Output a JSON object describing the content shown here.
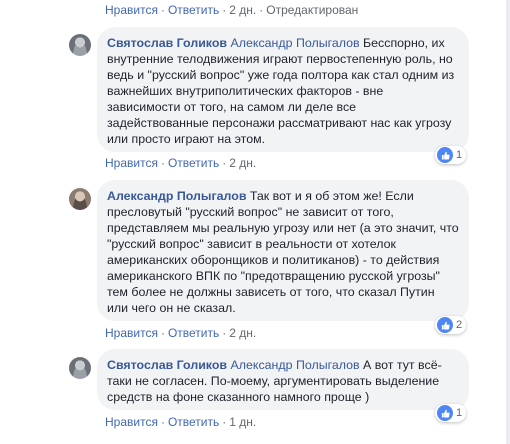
{
  "top_actions": {
    "like": "Нравится",
    "reply": "Ответить",
    "time": "2 дн.",
    "edited": "Отредактирован"
  },
  "comments": [
    {
      "author": "Святослав Голиков",
      "mention": "Александр Полыгалов",
      "text": " Бесспорно, их внутренние телодвижения играют первостепенную роль, но ведь и \"русский вопрос\" уже года полтора как стал одним из важнейших внутриполитических факторов - вне зависимости от того, на самом ли деле все задействованные персонажи рассматривают нас как угрозу или просто играют на этом.",
      "like": "Нравится",
      "reply": "Ответить",
      "time": "2 дн.",
      "reactions": "1"
    },
    {
      "author": "Александр Полыгалов",
      "mention": "",
      "text": " Так вот и я об этом же! Если пресловутый \"русский вопрос\" не зависит от того, представляем мы реальную угрозу или нет (а это значит, что \"русский вопрос\" зависит в реальности от хотелок американских оборонщиков и политиканов) - то действия американского ВПК по \"предотвращению русской угрозы\" тем более не должны зависеть от того, что сказал Путин или чего он не сказал.",
      "like": "Нравится",
      "reply": "Ответить",
      "time": "2 дн.",
      "reactions": "2"
    },
    {
      "author": "Святослав Голиков",
      "mention": "Александр Полыгалов",
      "text": " А вот тут всё-таки не согласен. По-моему, аргументировать выделение средств на фоне сказанного намного проще )",
      "like": "Нравится",
      "reply": "Ответить",
      "time": "1 дн.",
      "reactions": "1"
    }
  ],
  "colors": {
    "link": "#385898",
    "action_link": "#4267b2",
    "bubble": "#f2f3f5",
    "like_icon": "#4f86f6"
  },
  "icons": {
    "reaction": "thumbs-up-icon"
  }
}
